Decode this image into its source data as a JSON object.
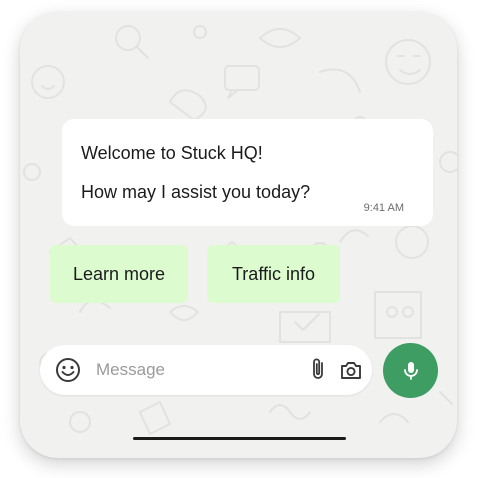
{
  "chat": {
    "message": {
      "line1": "Welcome to Stuck HQ!",
      "line2": "How may I assist you today?",
      "time": "9:41 AM"
    },
    "quick_replies": [
      {
        "label": "Learn more"
      },
      {
        "label": "Traffic info"
      }
    ]
  },
  "composer": {
    "placeholder": "Message",
    "icons": {
      "emoji": "smiley-icon",
      "attach": "paperclip-icon",
      "camera": "camera-icon",
      "mic": "microphone-icon"
    }
  },
  "colors": {
    "wallpaper": "#f1f1ef",
    "bubble": "#ffffff",
    "quick_reply": "#dcfcd0",
    "mic_button": "#3e9d63"
  }
}
